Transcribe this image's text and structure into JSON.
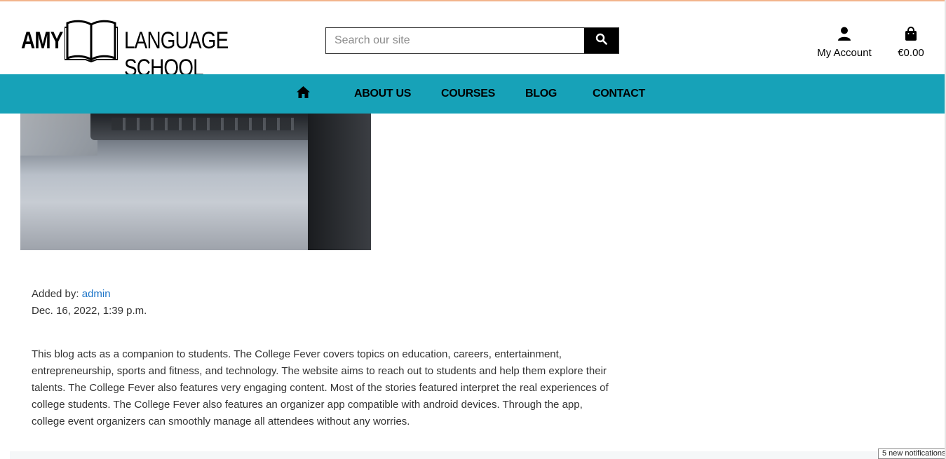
{
  "brand": {
    "name_part1": "AMY",
    "name_part2": "LANGUAGE SCHOOL",
    "logo_icon": "open-book-icon"
  },
  "search": {
    "placeholder": "Search our site",
    "button_icon": "search-icon"
  },
  "account": {
    "icon": "user-icon",
    "label": "My Account"
  },
  "bag": {
    "icon": "shopping-bag-icon",
    "total": "€0.00"
  },
  "nav": {
    "home_icon": "home-icon",
    "items": [
      {
        "label": "ABOUT US"
      },
      {
        "label": "COURSES"
      },
      {
        "label": "BLOG"
      },
      {
        "label": "CONTACT"
      }
    ]
  },
  "post": {
    "added_by_label": "Added by:",
    "author": "admin",
    "date": "Dec. 16, 2022, 1:39 p.m.",
    "body": "This blog acts as a companion to students. The College Fever covers topics on education, careers, entertainment, entrepreneurship, sports and fitness, and technology. The website aims to reach out to students and help them explore their talents. The College Fever also features very engaging content. Most of the stories featured interpret the real experiences of college students. The College Fever also features an organizer app compatible with android devices. Through the app, college event organizers can smoothly manage all attendees without any worries."
  },
  "notification": {
    "text": "5 new notifications"
  },
  "colors": {
    "nav_bg": "#17a2b8",
    "link": "#1a73c7",
    "top_accent": "#f2b48c"
  }
}
